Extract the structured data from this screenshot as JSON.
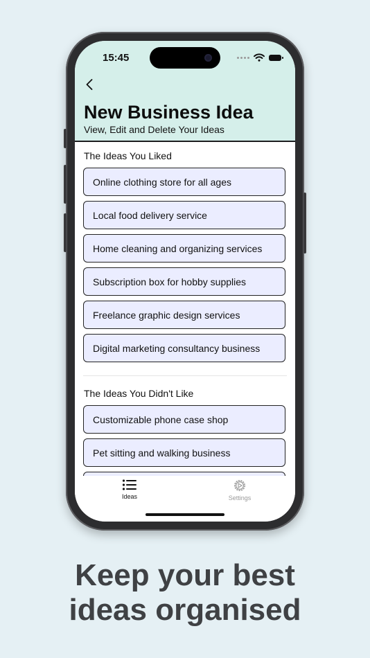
{
  "status_bar": {
    "time": "15:45"
  },
  "header": {
    "title": "New Business Idea",
    "subtitle": "View, Edit and Delete Your Ideas"
  },
  "liked": {
    "title": "The Ideas You Liked",
    "items": [
      "Online clothing store for all ages",
      "Local food delivery service",
      "Home cleaning and organizing services",
      "Subscription box for hobby supplies",
      "Freelance graphic design services",
      "Digital marketing consultancy business"
    ]
  },
  "disliked": {
    "title": "The Ideas You Didn't Like",
    "items": [
      "Customizable phone case shop",
      "Pet sitting and walking business",
      ""
    ]
  },
  "tabs": [
    {
      "label": "Ideas",
      "icon": "list-icon",
      "selected": true
    },
    {
      "label": "Settings",
      "icon": "gear-icon",
      "selected": false
    }
  ],
  "colors": {
    "background": "#e5f0f4",
    "header": "#d5efea",
    "card": "#ebedff",
    "caption": "#3f4144"
  },
  "caption": {
    "line1": "Keep your best",
    "line2": "ideas organised"
  }
}
